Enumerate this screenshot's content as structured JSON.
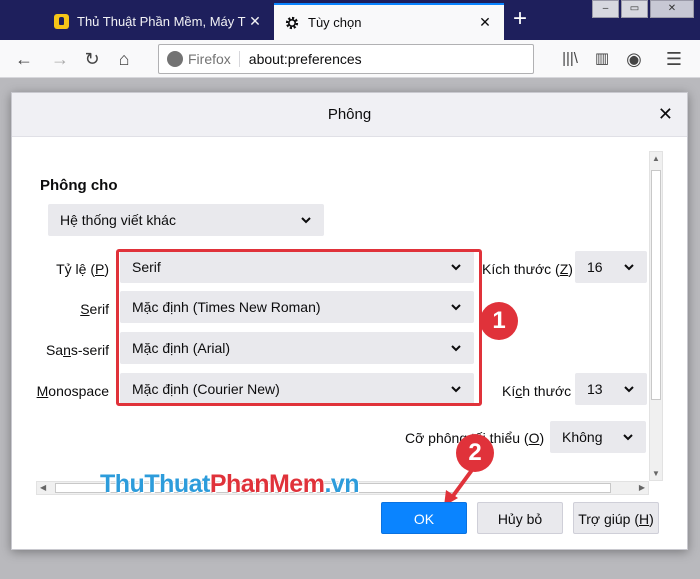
{
  "browser": {
    "tabs": [
      {
        "label": "Thủ Thuật Phần Mềm, Máy Tính",
        "icon": "bulb-favicon-icon",
        "active": false
      },
      {
        "label": "Tùy chọn",
        "icon": "gear-icon",
        "active": true
      }
    ],
    "url_identity": "Firefox",
    "url": "about:preferences"
  },
  "dialog": {
    "title": "Phông",
    "section_label": "Phông cho",
    "language_select": "Hệ thống viết khác",
    "rows": {
      "proportional": {
        "label_pre": "Tỷ lệ (",
        "label_key": "P",
        "label_post": ")",
        "value": "Serif"
      },
      "serif": {
        "label_key": "S",
        "label_post": "erif",
        "value": "Mặc định (Times New Roman)"
      },
      "sans": {
        "label_pre": "Sa",
        "label_key": "n",
        "label_post": "s-serif",
        "value": "Mặc định (Arial)"
      },
      "mono": {
        "label_key": "M",
        "label_post": "onospace",
        "value": "Mặc định (Courier New)"
      }
    },
    "size1": {
      "label_pre": "Kích thước (",
      "label_key": "Z",
      "label_post": ")",
      "value": "16"
    },
    "size2": {
      "label_pre": "Kí",
      "label_key": "c",
      "label_post": "h thước",
      "value": "13"
    },
    "min_size": {
      "label_pre": "Cỡ phông tối thiểu (",
      "label_key": "O",
      "label_post": ")",
      "value": "Không"
    },
    "buttons": {
      "ok": "OK",
      "cancel": "Hủy bỏ",
      "help_pre": "Trợ giúp (",
      "help_key": "H",
      "help_post": ")"
    }
  },
  "annotations": {
    "step1": "1",
    "step2": "2",
    "highlight_color": "#e0323a"
  },
  "watermark": {
    "part1": "ThuThuat",
    "part2": "PhanMem",
    "part3": ".vn"
  }
}
